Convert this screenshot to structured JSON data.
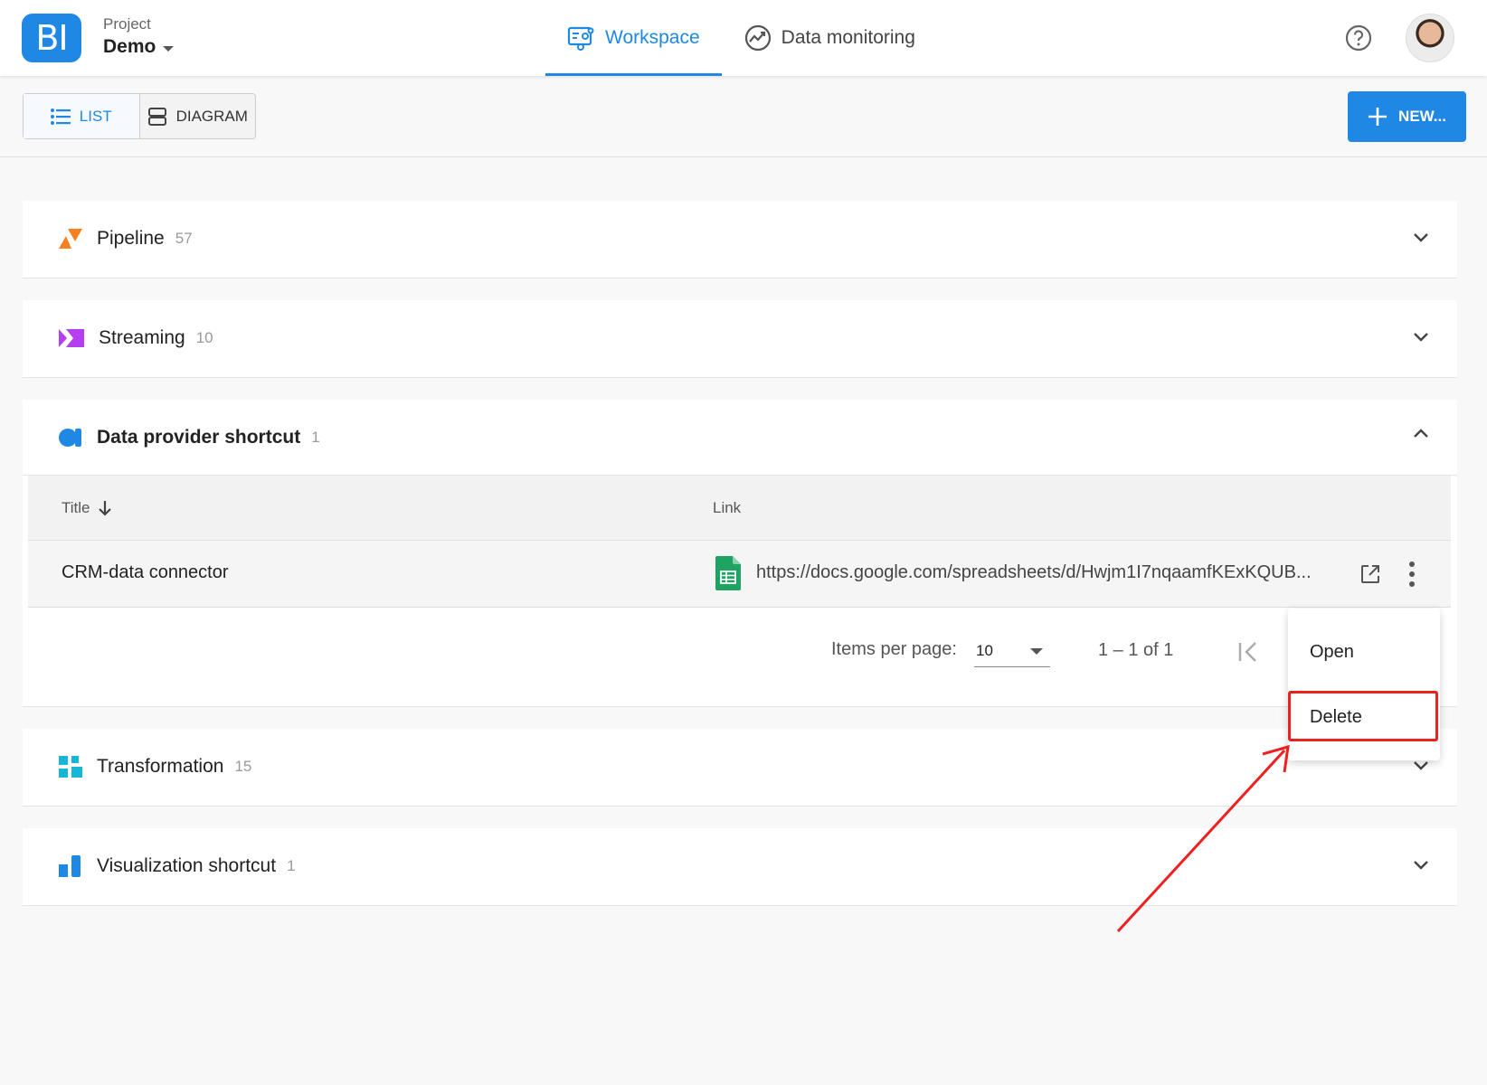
{
  "header": {
    "logo_text": "BI",
    "project_label": "Project",
    "project_name": "Demo",
    "tabs": [
      {
        "label": "Workspace",
        "active": true
      },
      {
        "label": "Data monitoring",
        "active": false
      }
    ]
  },
  "toolbar": {
    "list_label": "LIST",
    "diagram_label": "DIAGRAM",
    "new_label": "NEW..."
  },
  "sections": [
    {
      "title": "Pipeline",
      "count": "57",
      "expanded": false
    },
    {
      "title": "Streaming",
      "count": "10",
      "expanded": false
    },
    {
      "title": "Data provider shortcut",
      "count": "1",
      "expanded": true
    },
    {
      "title": "Transformation",
      "count": "15",
      "expanded": false
    },
    {
      "title": "Visualization shortcut",
      "count": "1",
      "expanded": false
    }
  ],
  "table": {
    "columns": [
      "Title",
      "Link"
    ],
    "rows": [
      {
        "title": "CRM-data connector",
        "link": "https://docs.google.com/spreadsheets/d/Hwjm1I7nqaamfKExKQUB..."
      }
    ],
    "items_per_page_label": "Items per page:",
    "items_per_page_value": "10",
    "range_label": "1 – 1 of 1"
  },
  "context_menu": {
    "items": [
      "Open",
      "Delete"
    ],
    "highlighted": "Delete"
  },
  "colors": {
    "accent": "#1f88e5",
    "highlight": "#ee2020",
    "pipeline": "#f5821f",
    "streaming": "#b43ef0",
    "data_provider": "#1f88e5",
    "transformation": "#16b6d6",
    "visualization": "#1f88e5",
    "sheets": "#1ea362"
  },
  "icons": [
    "help-icon",
    "workspace-icon",
    "monitoring-icon",
    "list-icon",
    "diagram-icon",
    "plus-icon",
    "sheets-icon",
    "external-link-icon",
    "more-vert-icon",
    "first-page-icon",
    "sort-down-icon"
  ]
}
